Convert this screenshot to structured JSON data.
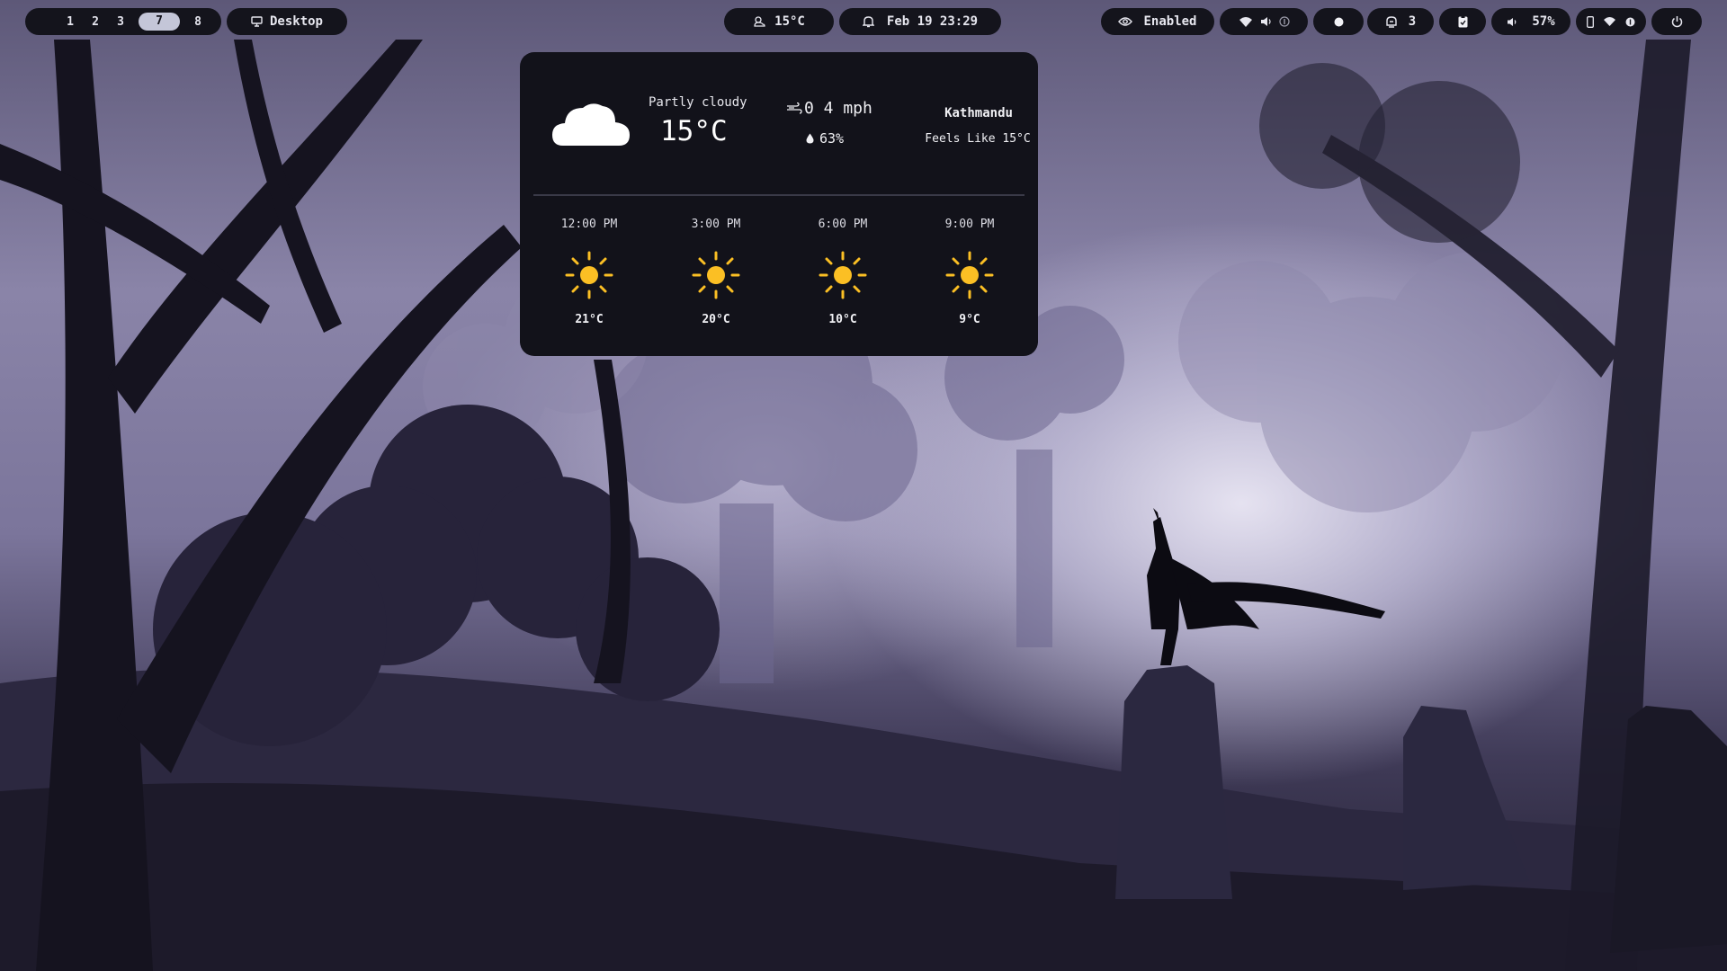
{
  "colors": {
    "bar_bg": "#14141c",
    "active_workspace": "#c4c6d8",
    "sun": "#fbbf24",
    "card_bg": "#12121a"
  },
  "topbar": {
    "workspaces": [
      "1",
      "2",
      "3",
      "7",
      "8"
    ],
    "active_workspace": "7",
    "desktop": {
      "icon": "monitor-icon",
      "label": "Desktop"
    },
    "weather": {
      "icon": "weather-icon",
      "label": "15°C"
    },
    "clock": {
      "icon": "bell-icon",
      "label": "Feb 19 23:29"
    },
    "idle_inhibitor": {
      "icon": "eye-icon",
      "label": "Enabled"
    },
    "network": {
      "icons": [
        "wifi-icon",
        "volume-icon",
        "info-icon"
      ]
    },
    "recording": {
      "icon": "record-dot-icon"
    },
    "updates": {
      "icon": "package-icon",
      "label": "3"
    },
    "clipboard": {
      "icon": "clipboard-icon"
    },
    "volume": {
      "icon": "speaker-icon",
      "label": "57%"
    },
    "tray": {
      "icons": [
        "phone-icon",
        "wifi-icon",
        "status-icon"
      ]
    },
    "power": {
      "icon": "power-icon"
    }
  },
  "weather_card": {
    "condition": "Partly cloudy",
    "temperature": "15°C",
    "wind": "0 4 mph",
    "humidity": "63%",
    "city": "Kathmandu",
    "feels_like": "Feels Like 15°C",
    "forecast": [
      {
        "time": "12:00 PM",
        "temp": "21°C",
        "icon": "sun-icon"
      },
      {
        "time": "3:00 PM",
        "temp": "20°C",
        "icon": "sun-icon"
      },
      {
        "time": "6:00 PM",
        "temp": "10°C",
        "icon": "sun-icon"
      },
      {
        "time": "9:00 PM",
        "temp": "9°C",
        "icon": "sun-icon"
      }
    ]
  }
}
